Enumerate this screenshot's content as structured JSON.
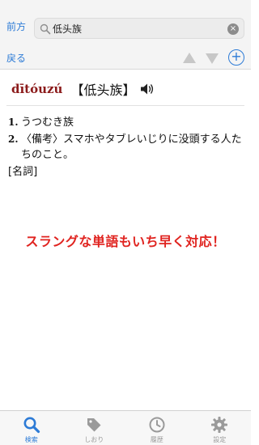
{
  "search": {
    "mode_label": "前方",
    "query": "低头族"
  },
  "nav": {
    "back_label": "戻る"
  },
  "entry": {
    "pinyin": "dītóuzú",
    "headword": "【低头族】",
    "definitions": [
      {
        "num": "1.",
        "text": "うつむき族"
      },
      {
        "num": "2.",
        "text": "〈備考〉スマホやタブレいじりに没頭する人たちのこと。"
      }
    ],
    "part_of_speech": "[名詞]"
  },
  "promo_text": "スラングな単語もいち早く対応！",
  "tabs": [
    {
      "label": "検索",
      "icon": "search-icon",
      "active": true
    },
    {
      "label": "しおり",
      "icon": "tag-icon",
      "active": false
    },
    {
      "label": "履歴",
      "icon": "clock-icon",
      "active": false
    },
    {
      "label": "設定",
      "icon": "gear-icon",
      "active": false
    }
  ],
  "colors": {
    "accent": "#2d7bd6",
    "pinyin": "#8b1a1a",
    "promo": "#e0231f",
    "inactive": "#9a9a9a"
  }
}
